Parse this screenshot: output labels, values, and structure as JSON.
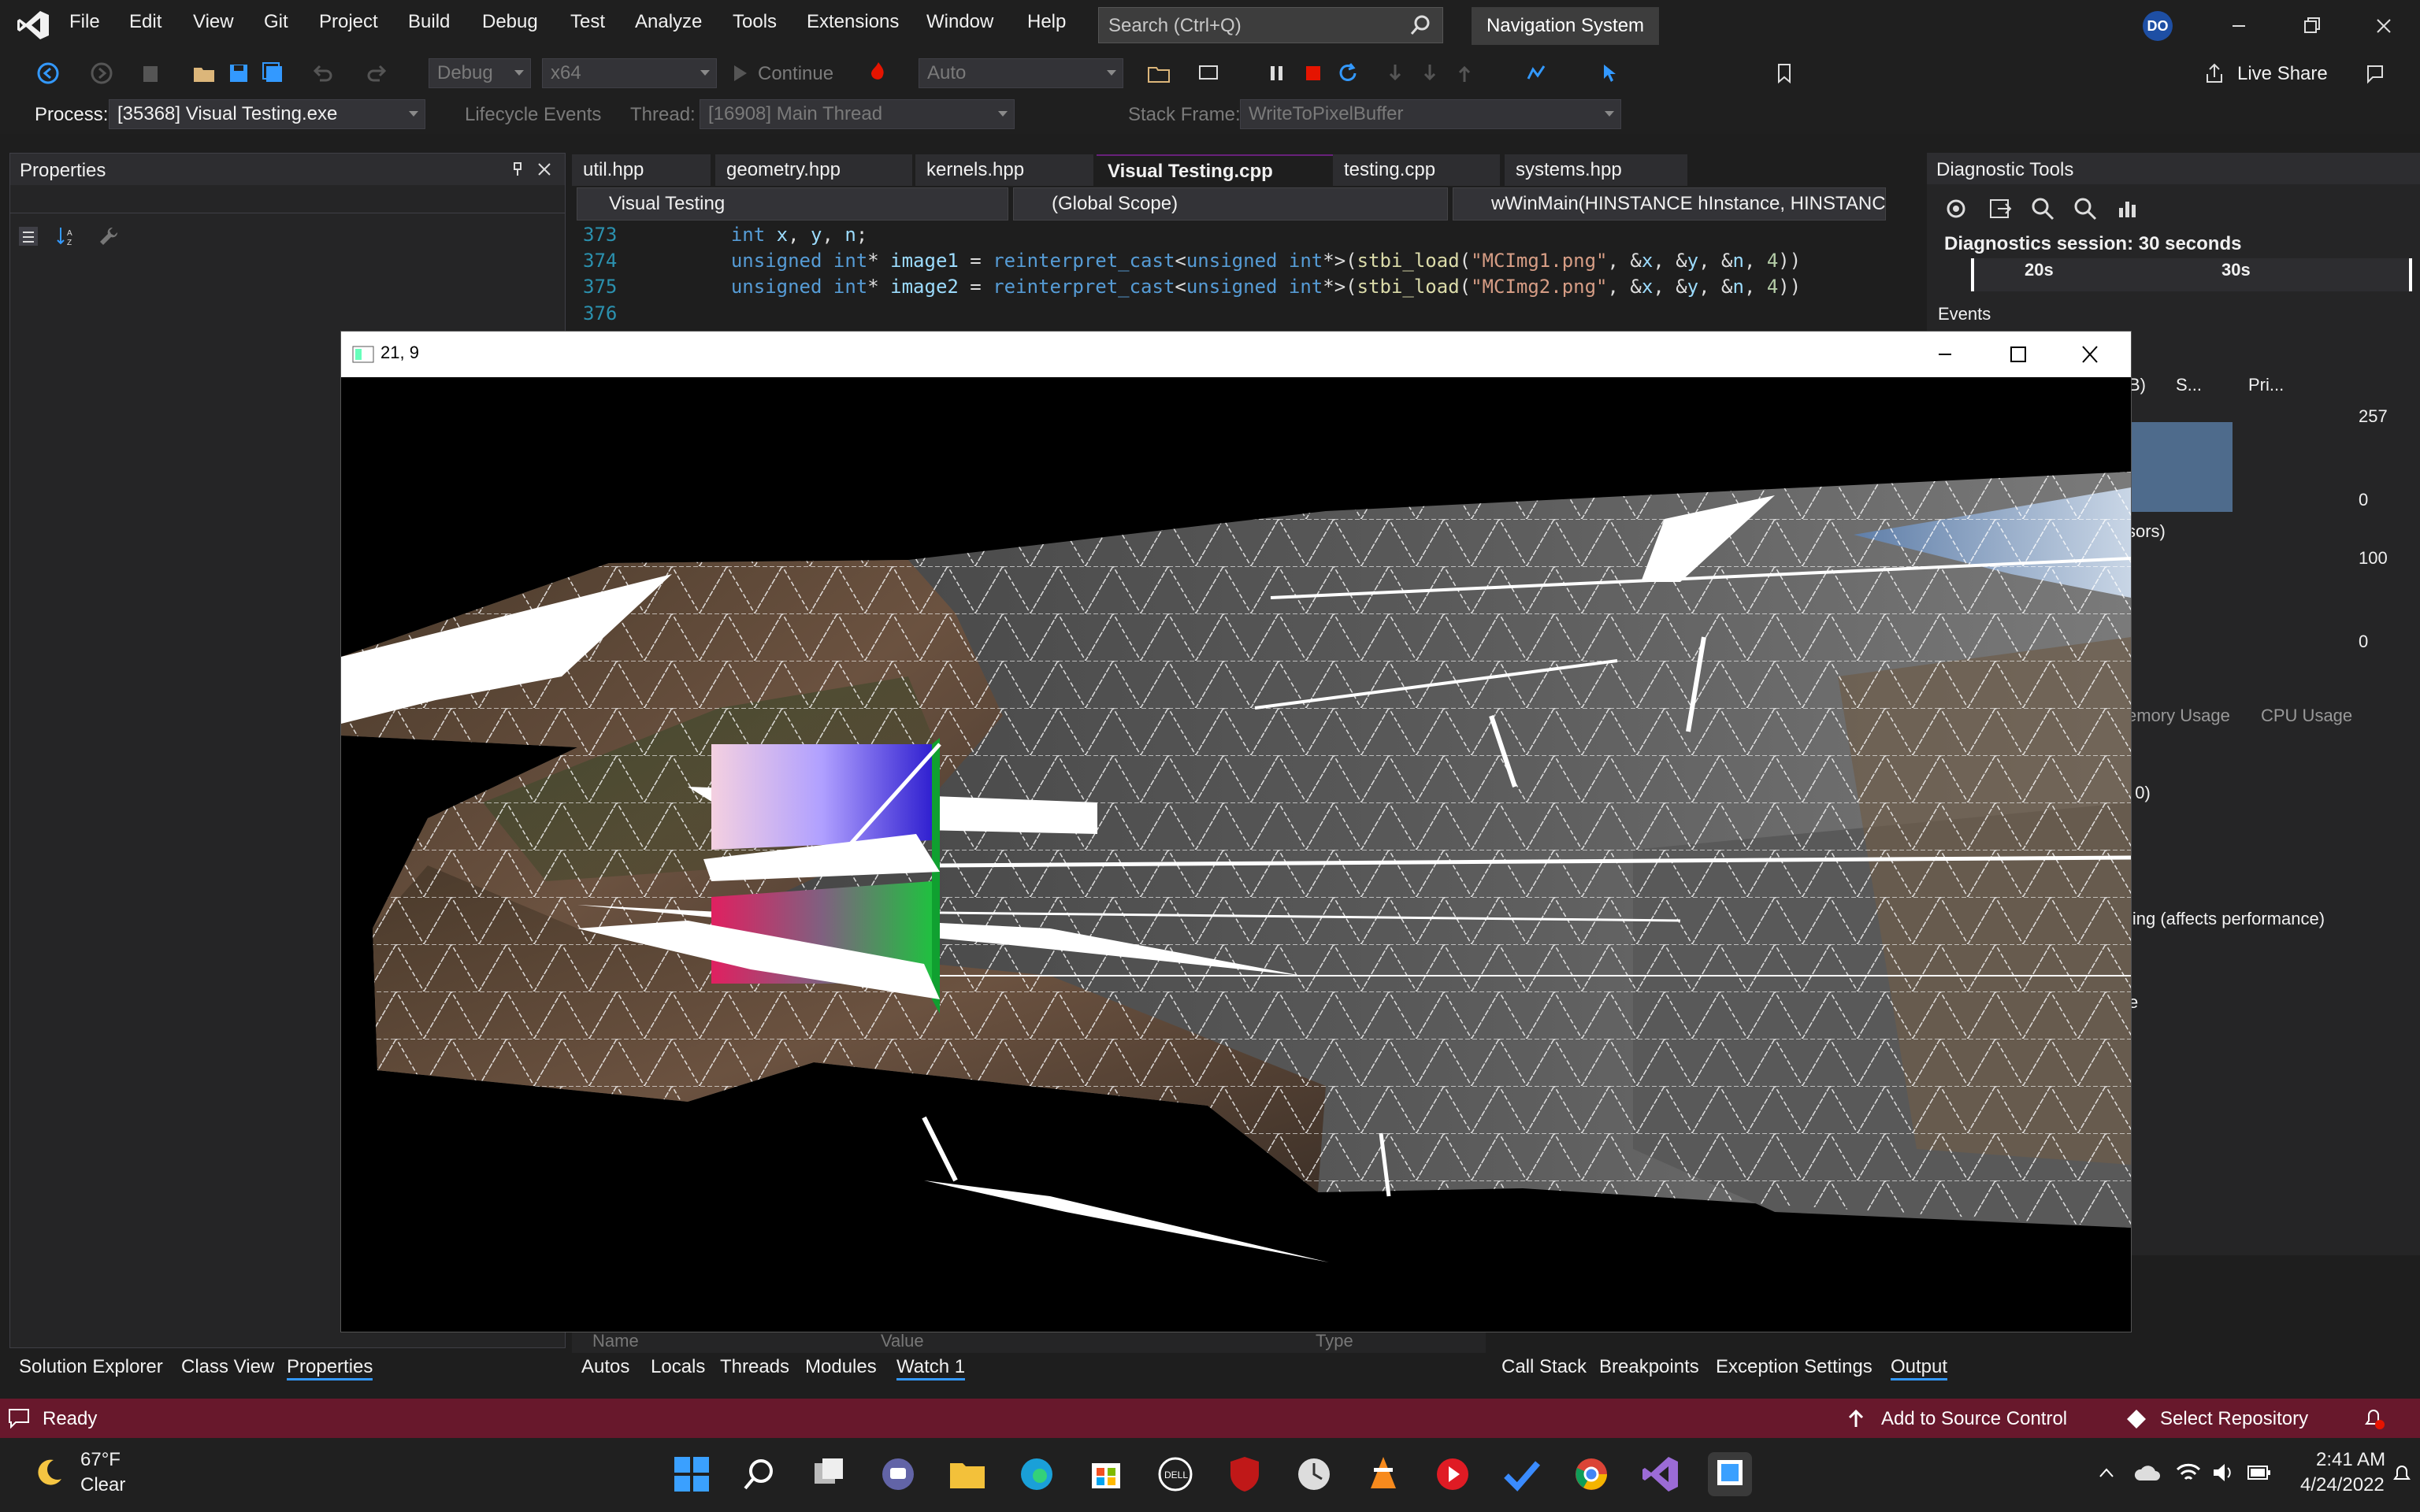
{
  "menu": {
    "items": [
      "File",
      "Edit",
      "View",
      "Git",
      "Project",
      "Build",
      "Debug",
      "Test",
      "Analyze",
      "Tools",
      "Extensions",
      "Window",
      "Help"
    ],
    "search_placeholder": "Search (Ctrl+Q)",
    "solution_name": "Navigation System",
    "avatar_initials": "DO"
  },
  "toolbar": {
    "config": "Debug",
    "platform": "x64",
    "continue_label": "Continue",
    "auto_label": "Auto",
    "live_share": "Live Share"
  },
  "debug_location": {
    "process_label": "Process:",
    "process_value": "[35368] Visual Testing.exe",
    "lifecycle_label": "Lifecycle Events",
    "thread_label": "Thread:",
    "thread_value": "[16908] Main Thread",
    "stack_frame_label": "Stack Frame:",
    "stack_frame_value": "WriteToPixelBuffer"
  },
  "properties_panel": {
    "title": "Properties",
    "tabs": [
      "Solution Explorer",
      "Class View",
      "Properties"
    ]
  },
  "editor": {
    "tabs": [
      "util.hpp",
      "geometry.hpp",
      "kernels.hpp",
      "Visual Testing.cpp",
      "testing.cpp",
      "systems.hpp"
    ],
    "active_tab": "Visual Testing.cpp",
    "project_combo": "Visual Testing",
    "scope_combo": "(Global Scope)",
    "function_combo": "wWinMain(HINSTANCE hInstance, HINSTANC",
    "lines": [
      {
        "num": "373"
      },
      {
        "num": "374"
      },
      {
        "num": "375"
      },
      {
        "num": "376"
      }
    ]
  },
  "watch_panel": {
    "columns": [
      "Name",
      "Value",
      "Type"
    ],
    "tabs": [
      "Autos",
      "Locals",
      "Threads",
      "Modules",
      "Watch 1"
    ]
  },
  "output_tabs": [
    "Call Stack",
    "Breakpoints",
    "Exception Settings",
    "Output"
  ],
  "app_window": {
    "title": "21, 9"
  },
  "diagnostics": {
    "title": "Diagnostic Tools",
    "session": "Diagnostics session: 30 seconds",
    "tick_20": "20s",
    "tick_30": "30s",
    "events_label": "Events",
    "legend_frag": "B)",
    "legend_s": "S...",
    "legend_pri": "Pri...",
    "mem_max": "257",
    "mem_min": "0",
    "cpu_frag": "sors)",
    "cpu_max": "100",
    "cpu_min": "0",
    "tab_memory": "emory Usage",
    "tab_cpu": "CPU Usage",
    "frag_1": "/ 0)",
    "frag_2": "ling (affects performance)",
    "frag_3": "e"
  },
  "status": {
    "ready": "Ready",
    "add_source": "Add to Source Control",
    "select_repo": "Select Repository"
  },
  "taskbar": {
    "weather_temp": "67°F",
    "weather_cond": "Clear",
    "time": "2:41 AM",
    "date": "4/24/2022"
  },
  "colors": {
    "accent": "#68217a",
    "status_bar": "#68182c",
    "vs_purple": "#9b6bd6"
  }
}
